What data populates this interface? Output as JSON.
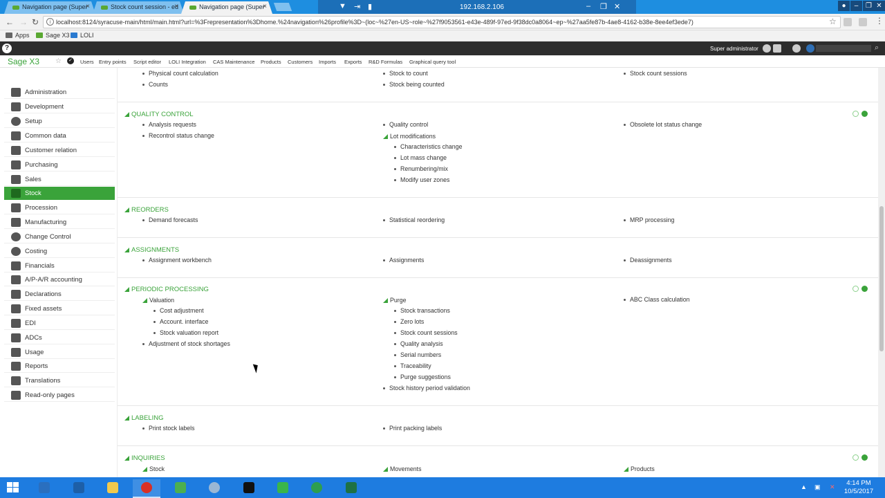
{
  "browser": {
    "tabs": [
      {
        "label": "Navigation page (Super",
        "active": false
      },
      {
        "label": "Stock count session - ed",
        "active": false
      },
      {
        "label": "Navigation page (Super",
        "active": true
      }
    ],
    "remote_ip": "192.168.2.106",
    "url": "localhost:8124/syracuse-main/html/main.html?url=%3Frepresentation%3Dhome.%24navigation%26profile%3D~(loc~%27en-US~role~%27f9053561-e43e-489f-97ed-9f38dc0a8064~ep~%27aa5fe87b-4ae8-4162-b38e-8ee4ef3ede7)",
    "bookmarks": [
      "Apps",
      "Sage X3",
      "LOLI"
    ]
  },
  "sage": {
    "help": "?",
    "user": "Super administrator",
    "brand": "Sage X3",
    "menu": [
      "Users",
      "Entry points",
      "Script editor",
      "LOLI Integration",
      "CAS Maintenance",
      "Products",
      "Customers",
      "Imports",
      "Exports",
      "R&D Formulas",
      "Graphical query tool"
    ]
  },
  "sidebar": {
    "items": [
      {
        "label": "Administration",
        "icon": "administration-icon"
      },
      {
        "label": "Development",
        "icon": "development-icon"
      },
      {
        "label": "Setup",
        "icon": "setup-gear-icon"
      },
      {
        "label": "Common data",
        "icon": "common-data-icon"
      },
      {
        "label": "Customer relation",
        "icon": "customer-relation-icon"
      },
      {
        "label": "Purchasing",
        "icon": "purchasing-icon"
      },
      {
        "label": "Sales",
        "icon": "sales-icon"
      },
      {
        "label": "Stock",
        "icon": "stock-icon"
      },
      {
        "label": "Procession",
        "icon": "procession-icon"
      },
      {
        "label": "Manufacturing",
        "icon": "manufacturing-icon"
      },
      {
        "label": "Change Control",
        "icon": "change-control-icon"
      },
      {
        "label": "Costing",
        "icon": "costing-icon"
      },
      {
        "label": "Financials",
        "icon": "financials-icon"
      },
      {
        "label": "A/P-A/R accounting",
        "icon": "ap-ar-accounting-icon"
      },
      {
        "label": "Declarations",
        "icon": "declarations-icon"
      },
      {
        "label": "Fixed assets",
        "icon": "fixed-assets-icon"
      },
      {
        "label": "EDI",
        "icon": "edi-icon"
      },
      {
        "label": "ADCs",
        "icon": "adcs-icon"
      },
      {
        "label": "Usage",
        "icon": "usage-icon"
      },
      {
        "label": "Reports",
        "icon": "reports-icon"
      },
      {
        "label": "Translations",
        "icon": "translations-icon"
      },
      {
        "label": "Read-only pages",
        "icon": "read-only-pages-icon"
      }
    ],
    "active_index": 7
  },
  "content": {
    "top_partial": {
      "col1": [
        "Physical count calculation",
        "Counts"
      ],
      "col2": [
        "Stock to count",
        "Stock being counted"
      ],
      "col3": [
        "Stock count sessions"
      ]
    },
    "quality_control": {
      "title": "QUALITY CONTROL",
      "col1": [
        "Analysis requests",
        "Recontrol status change"
      ],
      "col2_item": "Quality control",
      "col2_sub": "Lot modifications",
      "col2_sub_items": [
        "Characteristics change",
        "Lot mass change",
        "Renumbering/mix",
        "Modify user zones"
      ],
      "col3": [
        "Obsolete lot status change"
      ]
    },
    "reorders": {
      "title": "REORDERS",
      "col1": [
        "Demand forecasts"
      ],
      "col2": [
        "Statistical reordering"
      ],
      "col3": [
        "MRP processing"
      ]
    },
    "assignments": {
      "title": "ASSIGNMENTS",
      "col1": [
        "Assignment workbench"
      ],
      "col2": [
        "Assignments"
      ],
      "col3": [
        "Deassignments"
      ]
    },
    "periodic_processing": {
      "title": "PERIODIC PROCESSING",
      "col1_sub": "Valuation",
      "col1_sub_items": [
        "Cost adjustment",
        "Account. interface",
        "Stock valuation report"
      ],
      "col1_item": "Adjustment of stock shortages",
      "col2_sub": "Purge",
      "col2_sub_items": [
        "Stock transactions",
        "Zero lots",
        "Stock count sessions",
        "Quality analysis",
        "Serial numbers",
        "Traceability",
        "Purge suggestions"
      ],
      "col2_item": "Stock history period validation",
      "col3": [
        "ABC Class calculation"
      ]
    },
    "labeling": {
      "title": "LABELING",
      "col1": [
        "Print stock labels"
      ],
      "col2": [
        "Print packing labels"
      ]
    },
    "inquiries": {
      "title": "INQUIRIES",
      "col1_sub": "Stock",
      "col2_sub": "Movements",
      "col3_sub": "Products"
    }
  },
  "taskbar": {
    "time": "4:14 PM",
    "date": "10/5/2017"
  },
  "colors": {
    "accent_green": "#3aa33a",
    "taskbar_blue": "#1e7ce0",
    "dark_bar": "#2d2d2d"
  }
}
